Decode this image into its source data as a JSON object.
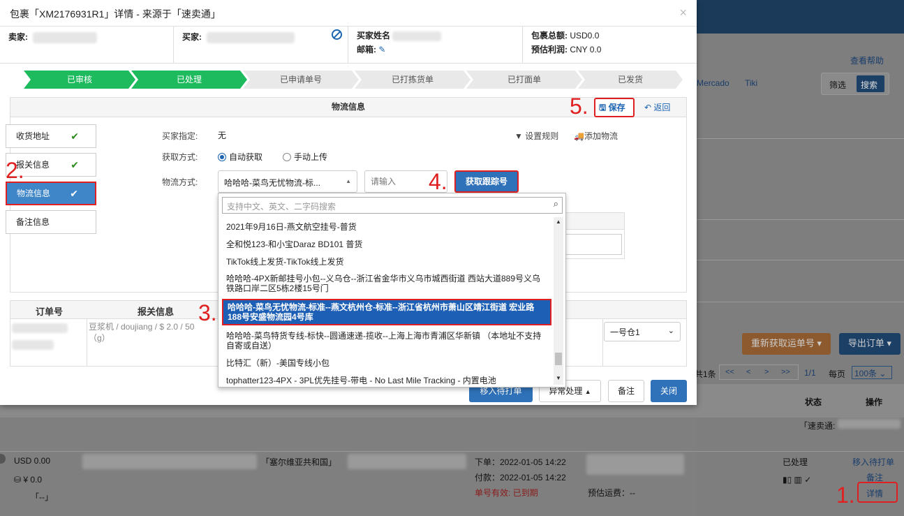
{
  "modal": {
    "title": "包裹「XM2176931R1」详情 - 来源于「速卖通」",
    "close": "×",
    "seller_label": "卖家:",
    "buyer_label": "买家:",
    "buyer_name_label": "买家姓名",
    "email_label": "邮箱:",
    "package_total_label": "包裹总额:",
    "package_total": "USD0.0",
    "est_profit_label": "预估利润:",
    "est_profit": "CNY 0.0"
  },
  "steps": [
    {
      "label": "已审核",
      "done": true
    },
    {
      "label": "已处理",
      "done": true
    },
    {
      "label": "已申请单号",
      "done": false
    },
    {
      "label": "已打拣货单",
      "done": false
    },
    {
      "label": "已打面单",
      "done": false
    },
    {
      "label": "已发货",
      "done": false
    }
  ],
  "panel": {
    "title": "物流信息",
    "save": "保存",
    "back": "返回",
    "buyer_assign_label": "买家指定:",
    "buyer_assign_value": "无",
    "fetch_mode_label": "获取方式:",
    "auto_fetch": "自动获取",
    "manual_upload": "手动上传",
    "shipping_method_label": "物流方式:",
    "shipping_method_value": "哈哈哈-菜鸟无忧物流-标...",
    "tracking_placeholder": "请输入",
    "fetch_tracking_btn": "获取跟踪号",
    "set_rules": "设置规则",
    "add_logistics": "添加物流"
  },
  "side_tabs": [
    {
      "label": "收货地址",
      "active": false
    },
    {
      "label": "报关信息",
      "active": false
    },
    {
      "label": "物流信息",
      "active": true
    },
    {
      "label": "备注信息",
      "active": false
    }
  ],
  "dropdown": {
    "search_placeholder": "支持中文、英文、二字码搜索",
    "options": [
      "2021年9月16日-燕文航空挂号-普货",
      "全和悦123-和小宝Daraz BD101 普货",
      "TikTok线上发货-TikTok线上发货",
      "哈哈哈-4PX新邮挂号小包--义乌仓--浙江省金华市义乌市城西街道 西站大道889号义乌铁路口岸二区5栋2楼15号门",
      "哈哈哈-菜鸟无忧物流-标准--燕文杭州仓-标准--浙江省杭州市萧山区靖江街道 宏业路188号安盛物流园4号库",
      "哈哈哈-菜鸟特货专线-标快--圆通速递-揽收--上海上海市青浦区华新镇 （本地址不支持自寄或自送）",
      "比特汇（新）-美国专线小包",
      "tophatter123-4PX - 3PL优先挂号-带电 - No Last Mile Tracking - 内置电池"
    ],
    "selected_index": 4
  },
  "order_table": {
    "col_order_no": "订单号",
    "col_customs": "报关信息",
    "customs_value": "豆浆机 / doujiang / $ 2.0 / 50",
    "customs_unit": "（g）",
    "warehouse": "一号仓1"
  },
  "footer_buttons": {
    "move_to_print": "移入待打单",
    "exception": "异常处理",
    "remark": "备注",
    "close": "关闭"
  },
  "markers": [
    "1.",
    "2.",
    "3.",
    "4.",
    "5."
  ],
  "background": {
    "help": "查看帮助",
    "platform_mercado": "Mercado",
    "platform_tiki": "Tiki",
    "filter": "筛选",
    "search": "搜索",
    "refetch_tracking": "重新获取运单号",
    "export_orders": "导出订单",
    "total_suffix": "共1条",
    "page_info": "1/1",
    "per_page_label": "每页",
    "per_page_value": "100条",
    "col_status": "状态",
    "col_action": "操作",
    "source": "「速卖通:",
    "row_amount": "USD 0.00",
    "row_cny": "¥ 0.0",
    "row_dash": "「--」",
    "row_country": "「塞尔维亚共和国」",
    "row_order_time": "下单：2022-01-05 14:22",
    "row_pay_time": "付款：2022-01-05 14:22",
    "row_tracking_valid": "单号有效:",
    "row_expired": "已到期",
    "row_est_freight": "预估运费：--",
    "row_status": "已处理",
    "action_move": "移入待打单",
    "action_remark": "备注",
    "action_detail": "详情"
  }
}
